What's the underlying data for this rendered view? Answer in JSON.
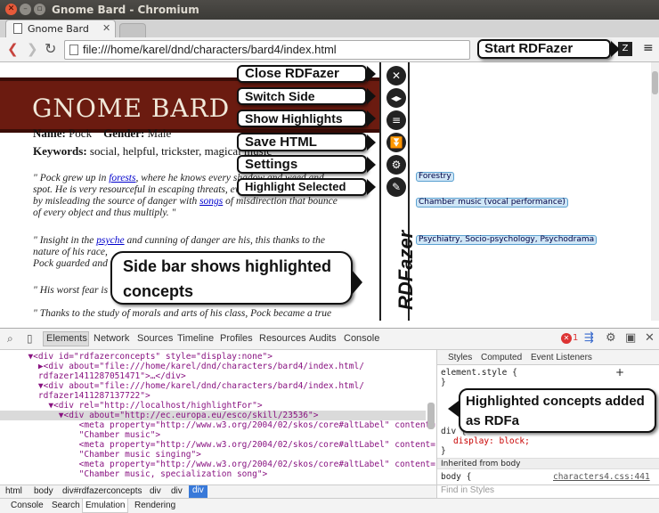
{
  "window": {
    "title": "Gnome Bard - Chromium"
  },
  "tabs": [
    {
      "label": "Gnome Bard"
    }
  ],
  "address": {
    "url": "file:///home/karel/dnd/characters/bard4/index.html"
  },
  "page": {
    "banner_title": "GNOME BARD",
    "name_label": "Name:",
    "name_value": "Pock",
    "gender_label": "Gender:",
    "gender_value": "Male",
    "keywords_label": "Keywords:",
    "keywords_value": "social, helpful, trickster, magical music",
    "q1": {
      "a": "\" Pock grew up in ",
      "link": "forests",
      "b": ", where he knows every shadow and weed and",
      "l2": "spot. He is very resourceful in escaping threats, even when",
      "l3a": "by misleading the source of danger with ",
      "link2": "songs",
      "l3b": " of misdirection that bounce",
      "l4": "of every object and thus multiply. \""
    },
    "q2": {
      "a": "\" Insight in the ",
      "link": "psyche",
      "b": " and cunning of danger are his, this thanks to the",
      "l2": "nature of his race,",
      "l3": "Pock guarded and"
    },
    "q3": "\" His worst fear is b",
    "q4": "\" Thanks to the study of morals and arts of his class, Pock became a true"
  },
  "rdfazer": {
    "label": "RDFazer",
    "buttons": [
      {
        "label": "Close RDFazer",
        "icon": "close-icon"
      },
      {
        "label": "Switch Side",
        "icon": "switch-side-icon"
      },
      {
        "label": "Show Highlights",
        "icon": "list-icon"
      },
      {
        "label": "Save HTML",
        "icon": "save-icon"
      },
      {
        "label": "Settings",
        "icon": "gear-icon"
      },
      {
        "label": "Highlight Selected",
        "icon": "highlight-icon"
      }
    ],
    "concepts": [
      "Forestry",
      "Chamber music (vocal performance)",
      "Psychiatry, Socio-psychology, Psychodrama"
    ]
  },
  "callouts": {
    "start": "Start RDFazer",
    "sidebar_l1": "Side bar shows highlighted",
    "sidebar_l2": "concepts",
    "rdfa_l1": "Highlighted concepts added",
    "rdfa_l2": "as RDFa"
  },
  "devtools": {
    "tabs": [
      "Elements",
      "Network",
      "Sources",
      "Timeline",
      "Profiles",
      "Resources",
      "Audits",
      "Console"
    ],
    "error_count": "1",
    "code": [
      {
        "t": "  ▼<div id=\"rdfazerconcepts\" style=\"display:none\">"
      },
      {
        "t": "    ▶<div about=\"file:///home/karel/dnd/characters/bard4/index.html/"
      },
      {
        "t": "    rdfazer1411287051471\">…</div>"
      },
      {
        "t": "    ▼<div about=\"file:///home/karel/dnd/characters/bard4/index.html/"
      },
      {
        "t": "    rdfazer1411287137722\">"
      },
      {
        "t": "      ▼<div rel=\"http://localhost/highlightFor\">"
      },
      {
        "t": "        ▼<div about=\"http://ec.europa.eu/esco/skill/23536\">"
      },
      {
        "t": "            <meta property=\"http://www.w3.org/2004/02/skos/core#altLabel\" content="
      },
      {
        "t": "            \"Chamber music\">"
      },
      {
        "t": "            <meta property=\"http://www.w3.org/2004/02/skos/core#altLabel\" content="
      },
      {
        "t": "            \"Chamber music singing\">"
      },
      {
        "t": "            <meta property=\"http://www.w3.org/2004/02/skos/core#altLabel\" content="
      },
      {
        "t": "            \"Chamber music, specialization song\">"
      }
    ],
    "styles_tabs": [
      "Styles",
      "Computed",
      "Event Listeners"
    ],
    "styles": {
      "l1": "element.style {",
      "l2": "}",
      "l3": "div {",
      "l4": "display: block;",
      "l5": "}",
      "inherited": "Inherited from body",
      "body": "body {",
      "source": "characters4.css:441",
      "find": "Find in Styles"
    },
    "breadcrumbs": [
      "html",
      "body",
      "div#rdfazerconcepts",
      "div",
      "div",
      "div"
    ],
    "drawer_tabs": [
      "Console",
      "Search",
      "Emulation",
      "Rendering"
    ]
  },
  "colors": {
    "accent": "#6b1b10",
    "selection": "#3879d9"
  }
}
